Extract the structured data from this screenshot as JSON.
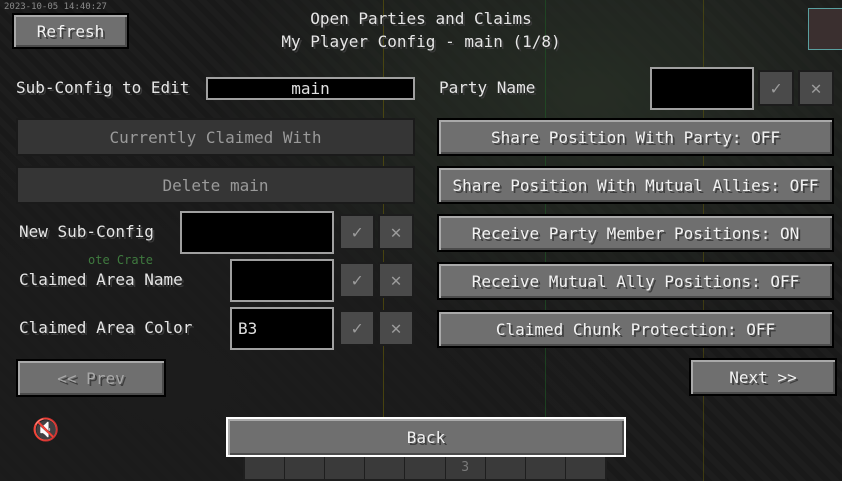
{
  "background": {
    "overlay_text": "ote Crate",
    "timestamp": "2023-10-05 14:40:27"
  },
  "header": {
    "title": "Open Parties and Claims",
    "subtitle": "My Player Config - main (1/8)",
    "refresh_label": "Refresh"
  },
  "left": {
    "sub_config_label": "Sub-Config to Edit",
    "sub_config_value": "main",
    "currently_claimed_label": "Currently Claimed With",
    "delete_label": "Delete main",
    "new_sub_config_label": "New Sub-Config",
    "new_sub_config_value": "",
    "claimed_area_name_label": "Claimed Area Name",
    "claimed_area_name_value": "",
    "claimed_area_color_label": "Claimed Area Color",
    "claimed_area_color_value": "B3",
    "prev_label": "<< Prev"
  },
  "right": {
    "party_name_label": "Party Name",
    "party_name_value": "",
    "share_position_party": "Share Position With Party: OFF",
    "share_position_allies": "Share Position With Mutual Allies: OFF",
    "receive_party_positions": "Receive Party Member Positions: ON",
    "receive_ally_positions": "Receive Mutual Ally Positions: OFF",
    "claimed_chunk_protection": "Claimed Chunk Protection: OFF",
    "next_label": "Next >>"
  },
  "footer": {
    "back_label": "Back",
    "hotbar_count": "3"
  },
  "icons": {
    "confirm": "✓",
    "cancel": "✕"
  },
  "colors": {
    "button": "#6f6f6f",
    "disabled_button": "#353535",
    "field_bg": "#000000",
    "text": "#e6e6e6"
  }
}
